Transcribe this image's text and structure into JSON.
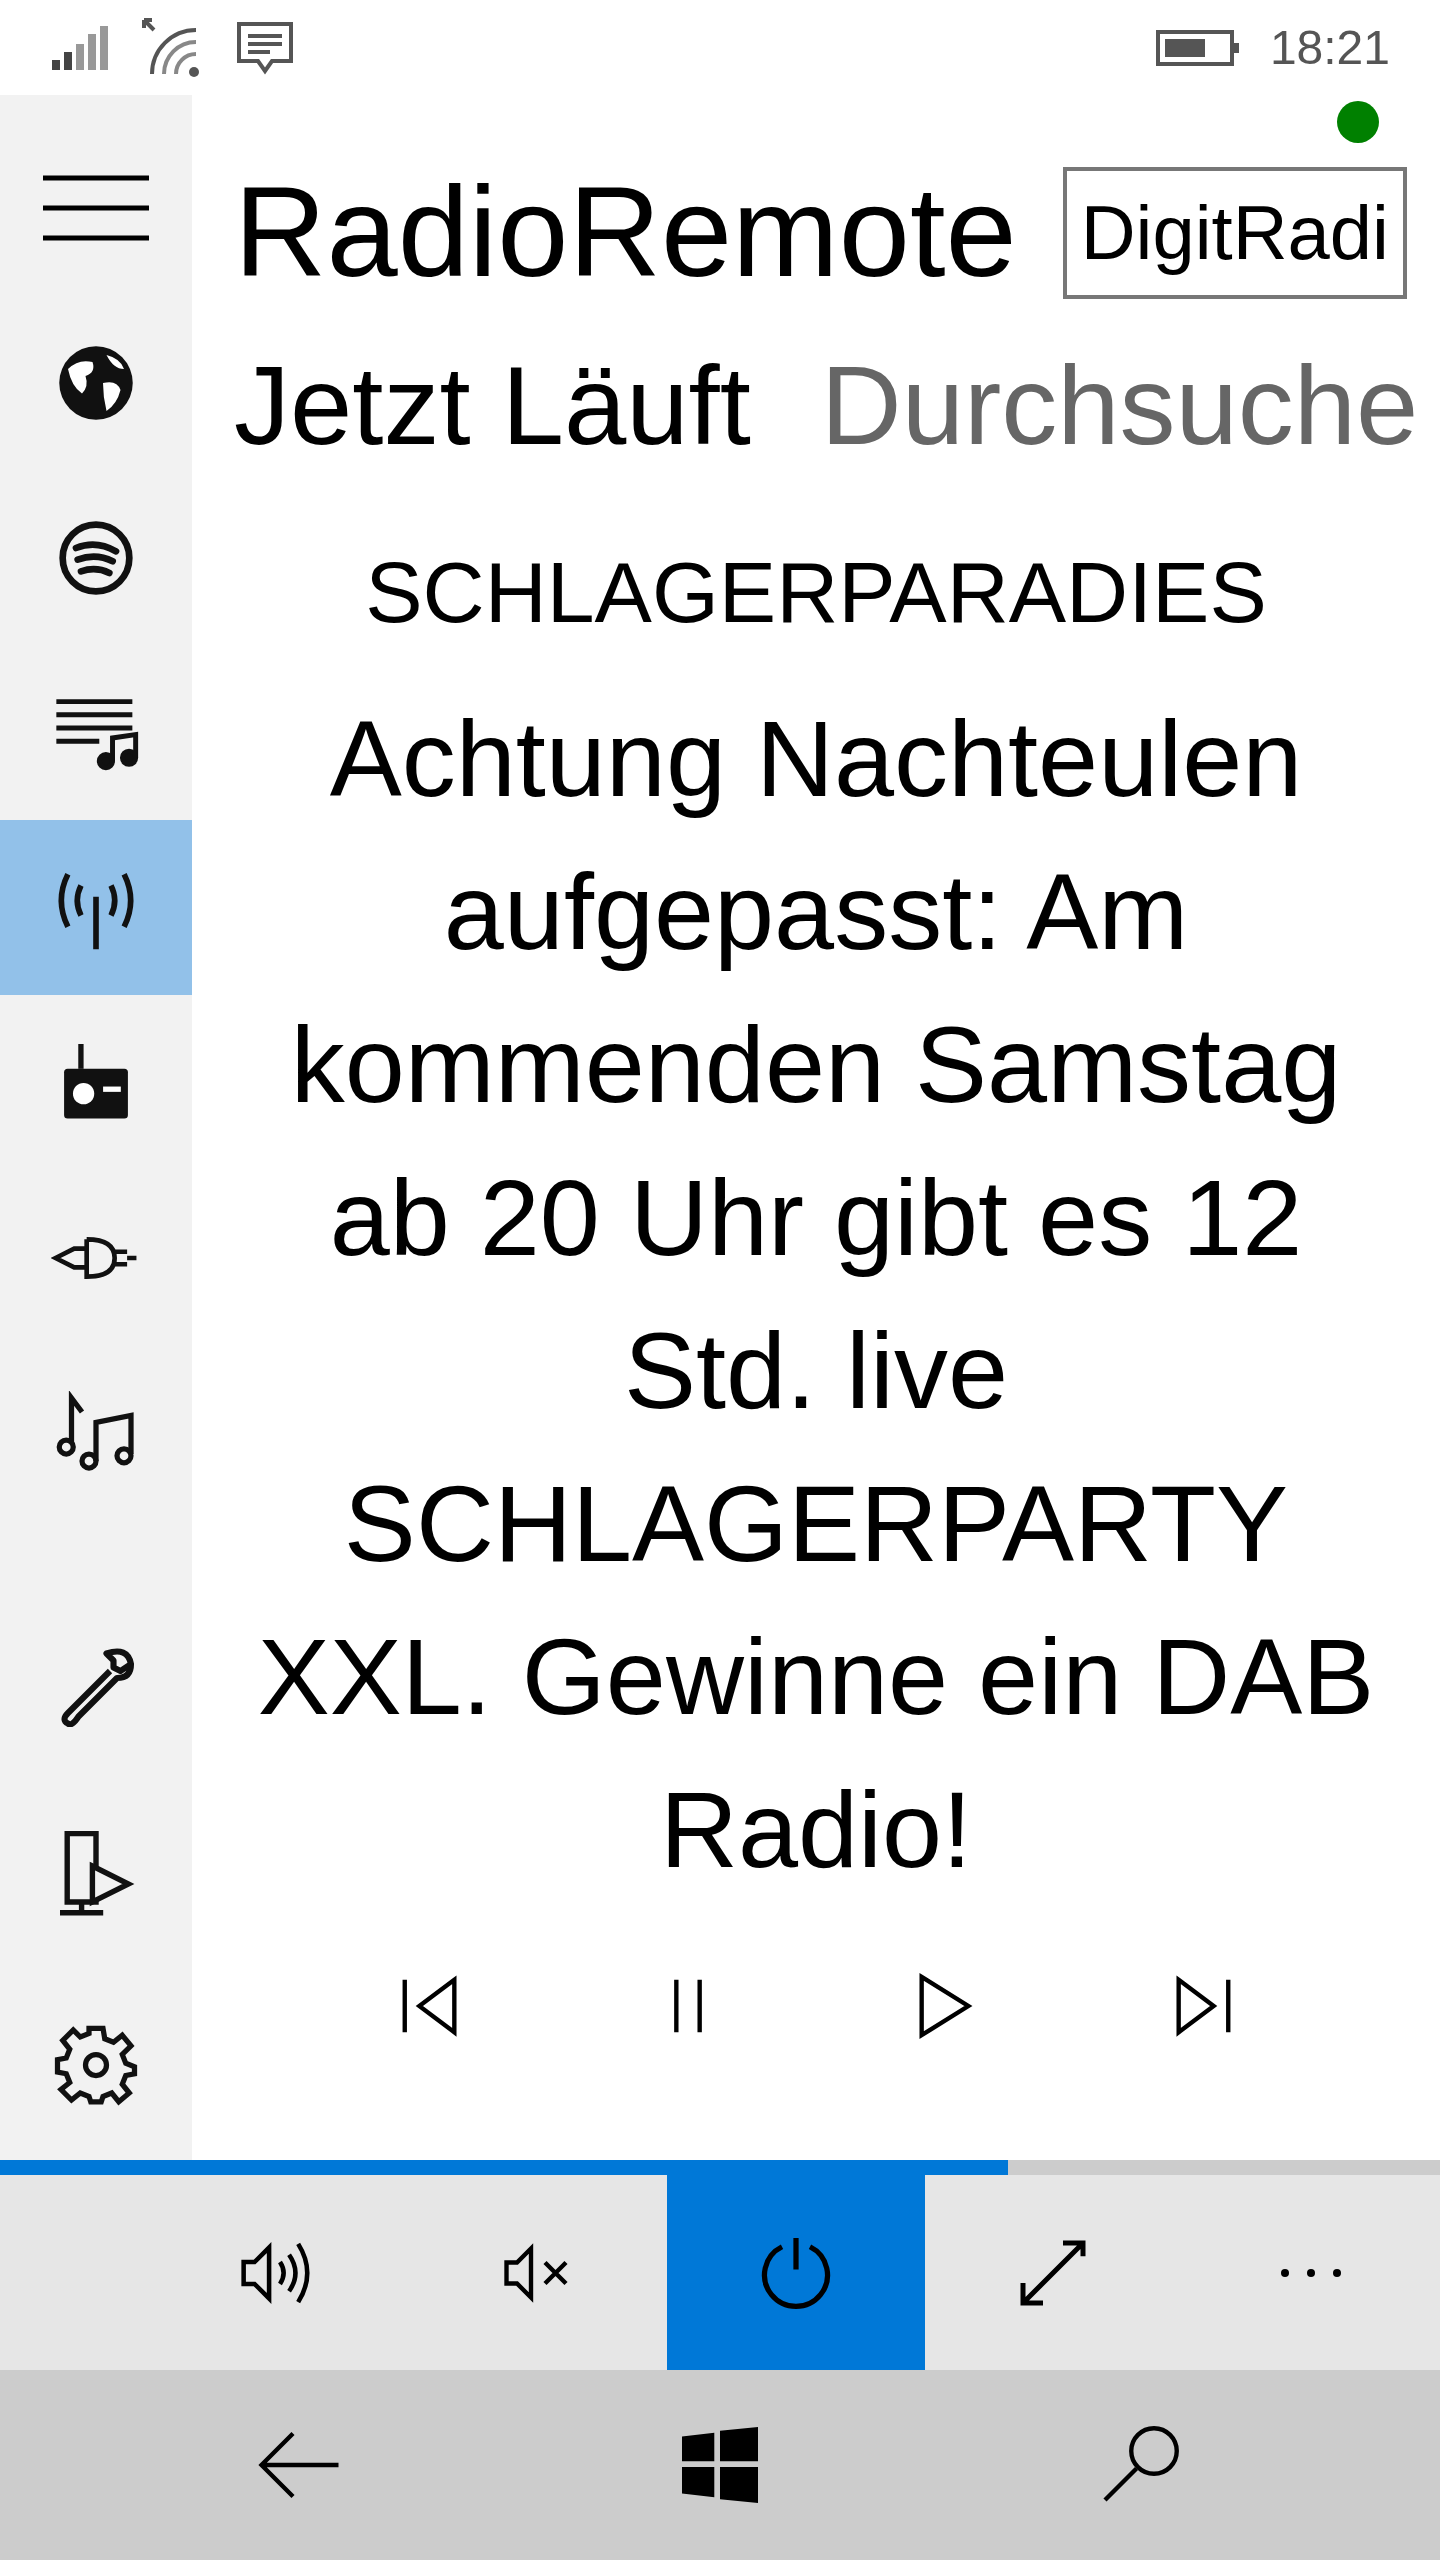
{
  "status_bar": {
    "time": "18:21"
  },
  "sidebar": {
    "items": [
      {
        "selected": false
      },
      {
        "selected": false
      },
      {
        "selected": false
      },
      {
        "selected": true
      },
      {
        "selected": false
      },
      {
        "selected": false
      },
      {
        "selected": false
      },
      {
        "selected": false
      },
      {
        "selected": false
      },
      {
        "selected": false
      }
    ]
  },
  "header": {
    "title": "RadioRemote",
    "device": "DigitRadi",
    "device_online": true
  },
  "tabs": [
    {
      "label": "Jetzt Läuft",
      "selected": true
    },
    {
      "label": "Durchsuche",
      "selected": false
    }
  ],
  "now_playing": {
    "station": "SCHLAGERPARADIES",
    "text": "Achtung Nachteulen aufgepasst: Am kommenden Samstag ab 20 Uhr gibt es 12 Std. live SCHLAGERPARTY XXL. Gewinne ein DAB Radio!"
  },
  "progress": {
    "level": 0.7
  },
  "app_bar": {
    "power": {
      "on": true
    }
  }
}
